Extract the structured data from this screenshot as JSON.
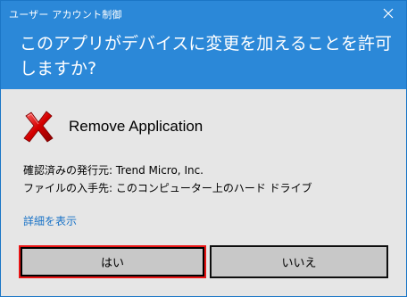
{
  "window": {
    "title": "ユーザー アカウント制御",
    "question": "このアプリがデバイスに変更を加えることを許可しますか?"
  },
  "app": {
    "name": "Remove Application",
    "icon": "red-x-icon"
  },
  "details": {
    "publisher": "確認済みの発行元: Trend Micro, Inc.",
    "origin": "ファイルの入手先: このコンピューター上のハード ドライブ"
  },
  "links": {
    "show_details": "詳細を表示"
  },
  "buttons": {
    "yes": "はい",
    "no": "いいえ"
  },
  "colors": {
    "header": "#2b88d8",
    "body": "#e6e6e6",
    "link": "#1a73c7",
    "focus_highlight": "#e81515"
  }
}
